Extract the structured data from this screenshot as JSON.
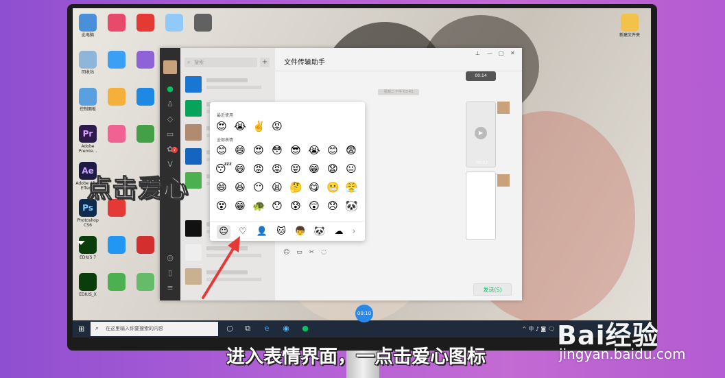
{
  "annotation": "点击爱心",
  "caption": "进入表情界面，一点击爱心图标",
  "watermark": {
    "brand": "Bai经验",
    "url": "jingyan.baidu.com"
  },
  "desktop": {
    "icons": [
      {
        "label": "此电脑",
        "color": "#4a90d9"
      },
      {
        "label": "回收站",
        "color": "#8fb6d8"
      },
      {
        "label": "控制面板",
        "color": "#5aa0e0"
      },
      {
        "label": "Pr",
        "sub": "Adobe Premie...",
        "color": "#2b1a4a"
      },
      {
        "label": "Ae",
        "sub": "Adobe After Effects",
        "color": "#1d1b44"
      },
      {
        "label": "Ps",
        "sub": "Photoshop CS6",
        "color": "#0f2a4a"
      },
      {
        "label": "EDIUS 7",
        "color": "#0b3d0b"
      },
      {
        "label": "EDIUS_X",
        "color": "#0b3d0b"
      },
      {
        "label": "新建文件夹",
        "color": "#f2c24b"
      }
    ]
  },
  "wechat": {
    "search_placeholder": "搜索",
    "chat_title": "文件传输助手",
    "time_label": "星期二 下午 03:43",
    "video1_time": "00:14",
    "video2_time": "00:12",
    "send_label": "发送(S)",
    "sidebar_badge": "7",
    "emoji_panel": {
      "recent_label": "最近使用",
      "all_label": "全部表情",
      "recent": [
        "😍",
        "😭",
        "✌️",
        "😡"
      ],
      "all_rows": [
        [
          "😊",
          "😄",
          "😍",
          "😳",
          "😎",
          "😭",
          "😊",
          "😨"
        ],
        [
          "😴",
          "😄",
          "😡",
          "😡",
          "😝",
          "😁",
          "😧",
          "😐"
        ],
        [
          "😄",
          "😆",
          "😶",
          "😫",
          "🤔",
          "😋",
          "😬",
          "😤"
        ],
        [
          "😵",
          "😁",
          "🐢",
          "😯",
          "😰",
          "😲",
          "😞",
          "🐼"
        ]
      ],
      "tabs": [
        "☺",
        "♡",
        "👤",
        "🐱",
        "👦",
        "🐼",
        "☁",
        "›"
      ]
    }
  },
  "taskbar": {
    "search_placeholder": "在这里输入你要搜索的内容",
    "tray_text": "^ 中 ♪ ◙ 🗨",
    "timer": "00:10"
  }
}
